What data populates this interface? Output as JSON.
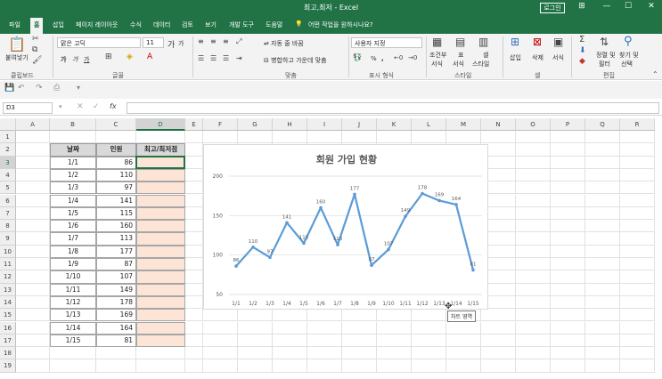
{
  "window": {
    "title": "최고,최저 - Excel",
    "login": "로그인",
    "controls": {
      "ribbon_options": "⊞",
      "minimize": "—",
      "restore": "☐",
      "close": "✕"
    }
  },
  "tabs": [
    "파일",
    "홈",
    "삽입",
    "페이지 레이아웃",
    "수식",
    "데이터",
    "검토",
    "보기",
    "개발 도구",
    "도움말"
  ],
  "tell_me": "어떤 작업을 원하시나요?",
  "ribbon": {
    "clipboard": {
      "group": "클립보드",
      "paste": "붙여넣기"
    },
    "font": {
      "group": "글꼴",
      "name": "맑은 고딕",
      "size": "11",
      "bold": "가",
      "italic": "가",
      "underline": "가",
      "inc": "가",
      "dec": "가"
    },
    "align": {
      "group": "맞춤",
      "wrap": "자동 줄 바꿈",
      "merge": "병합하고 가운데 맞춤"
    },
    "number": {
      "group": "표시 형식",
      "format": "사용자 지정",
      "percent": "%",
      "comma": ","
    },
    "styles": {
      "group": "스타일",
      "cond": [
        "조건부",
        "서식"
      ],
      "table": [
        "표",
        "서식"
      ],
      "cell": [
        "셀",
        "스타일"
      ]
    },
    "cells": {
      "group": "셀",
      "insert": "삽입",
      "delete": "삭제",
      "format": "서식"
    },
    "editing": {
      "group": "편집",
      "sort": [
        "정렬 및",
        "필터"
      ],
      "find": [
        "찾기 및",
        "선택"
      ]
    }
  },
  "formula_bar": {
    "name_box": "D3",
    "fx": "fx",
    "value": ""
  },
  "columns": [
    "A",
    "B",
    "C",
    "D",
    "E",
    "F",
    "G",
    "H",
    "I",
    "J",
    "K",
    "L",
    "M",
    "N",
    "O",
    "P",
    "Q",
    "R"
  ],
  "rows": [
    "1",
    "2",
    "3",
    "4",
    "5",
    "6",
    "7",
    "8",
    "9",
    "10",
    "11",
    "12",
    "13",
    "14",
    "15",
    "16",
    "17",
    "18",
    "19"
  ],
  "selected_cell": "D3",
  "table": {
    "headers": [
      "날짜",
      "인원",
      "최고/최저점"
    ],
    "rows": [
      [
        "1/1",
        "86",
        ""
      ],
      [
        "1/2",
        "110",
        ""
      ],
      [
        "1/3",
        "97",
        ""
      ],
      [
        "1/4",
        "141",
        ""
      ],
      [
        "1/5",
        "115",
        ""
      ],
      [
        "1/6",
        "160",
        ""
      ],
      [
        "1/7",
        "113",
        ""
      ],
      [
        "1/8",
        "177",
        ""
      ],
      [
        "1/9",
        "87",
        ""
      ],
      [
        "1/10",
        "107",
        ""
      ],
      [
        "1/11",
        "149",
        ""
      ],
      [
        "1/12",
        "178",
        ""
      ],
      [
        "1/13",
        "169",
        ""
      ],
      [
        "1/14",
        "164",
        ""
      ],
      [
        "1/15",
        "81",
        ""
      ]
    ]
  },
  "chart_data": {
    "type": "line",
    "title": "회원 가입 현황",
    "categories": [
      "1/1",
      "1/2",
      "1/3",
      "1/4",
      "1/5",
      "1/6",
      "1/7",
      "1/8",
      "1/9",
      "1/10",
      "1/11",
      "1/12",
      "1/13",
      "1/14",
      "1/15"
    ],
    "values": [
      86,
      110,
      97,
      141,
      115,
      160,
      113,
      177,
      87,
      107,
      149,
      178,
      169,
      164,
      81
    ],
    "ylim": [
      50,
      200
    ],
    "yticks": [
      50,
      100,
      150,
      200
    ],
    "grid": true,
    "legend": "none",
    "color": "#5b9bd5"
  },
  "tooltip": "차트 영역"
}
